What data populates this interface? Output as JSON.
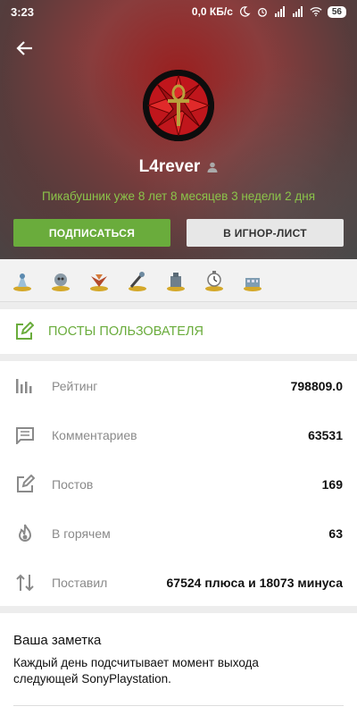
{
  "statusbar": {
    "time": "3:23",
    "net_speed": "0,0 КБ/с",
    "battery": "56"
  },
  "profile": {
    "username": "L4rever",
    "tenure": "Пикабушник уже 8 лет 8 месяцев 3 недели 2 дня",
    "subscribe_label": "ПОДПИСАТЬСЯ",
    "ignore_label": "В ИГНОР-ЛИСТ"
  },
  "colors": {
    "accent": "#6aac3c",
    "tenure": "#8bc34a",
    "avatar_red": "#c0161c",
    "ankh_gold": "#b9a03c"
  },
  "awards": [
    "award-1",
    "award-2",
    "award-3",
    "award-4",
    "award-5",
    "award-6",
    "award-7"
  ],
  "posts": {
    "label": "ПОСТЫ ПОЛЬЗОВАТЕЛЯ"
  },
  "stats": [
    {
      "label": "Рейтинг",
      "value": "798809.0",
      "icon": "bar-chart-icon"
    },
    {
      "label": "Комментариев",
      "value": "63531",
      "icon": "comment-icon"
    },
    {
      "label": "Постов",
      "value": "169",
      "icon": "edit-icon"
    },
    {
      "label": "В горячем",
      "value": "63",
      "icon": "flame-icon"
    },
    {
      "label": "Поставил",
      "value": "67524 плюса и 18073 минуса",
      "icon": "up-down-arrows-icon"
    }
  ],
  "note": {
    "title": "Ваша заметка",
    "text": "Каждый день подсчитывает момент выхода следующей SonyPlaystation."
  }
}
